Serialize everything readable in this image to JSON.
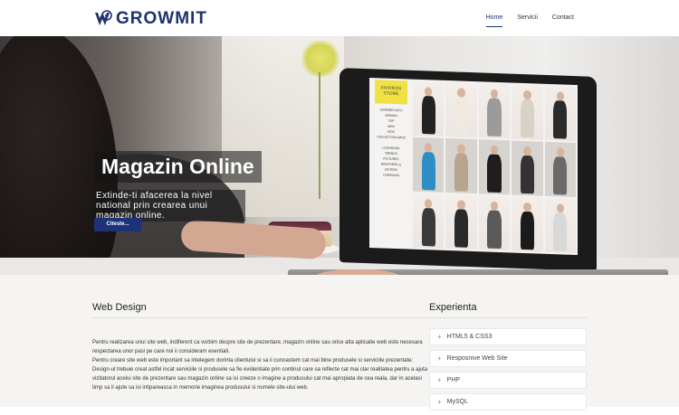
{
  "header": {
    "logo_text": "GROWMIT",
    "nav": [
      {
        "label": "Home",
        "active": true
      },
      {
        "label": "Servicii",
        "active": false
      },
      {
        "label": "Contact",
        "active": false
      }
    ]
  },
  "hero": {
    "title": "Magazin Online",
    "subtitle": "Extinde-ti afacerea la nivel national prin crearea unui magazin online.",
    "button_label": "Citeste...",
    "screen": {
      "store_label": "FASHION STORE",
      "menu": [
        "SUMMER DAYS",
        "WOMAN",
        "TOP",
        "MAN",
        "KIDS",
        "COLLECTION AW15",
        "",
        "LOOKBOOK",
        "TRENDS",
        "PICTURES",
        "BROTHERS &",
        "SISTERS",
        "CAMPAIGN"
      ]
    }
  },
  "web_design": {
    "title": "Web Design",
    "paragraphs": [
      "Pentru realizarea unui site web, indiferent ca vorbim despre site de prezentare, magazin online sau orice alta aplicatie web este necesara respectarea unor pasi pe care noi ii consideram esentiali.",
      "Pentru creare site web este important sa intelegem dorinta clientului si sa ii cunoastem cat mai bine produsele si serviciile prezentate:",
      "Design-ul trebuie creat astfel incat serviciile si produsele sa fie evidentiate prin continut care sa reflecte cat mai clar realitatea pentru a ajuta vizitatorul acelui site de prezentare sau magazin online sa isi creeze o imagine a produsului cat mai apropiata de cea reala, dar in acelasi timp sa il ajute sa isi intipareasca in memorie imaginea produsului si numele site-ului web."
    ]
  },
  "experience": {
    "title": "Experienta",
    "items": [
      "HTML5 & CSS3",
      "Resposnive Web Site",
      "PHP",
      "MySQL"
    ]
  },
  "colors": {
    "brand": "#1d3270",
    "button": "#1d3278",
    "section_bg": "#f5f4f2"
  }
}
